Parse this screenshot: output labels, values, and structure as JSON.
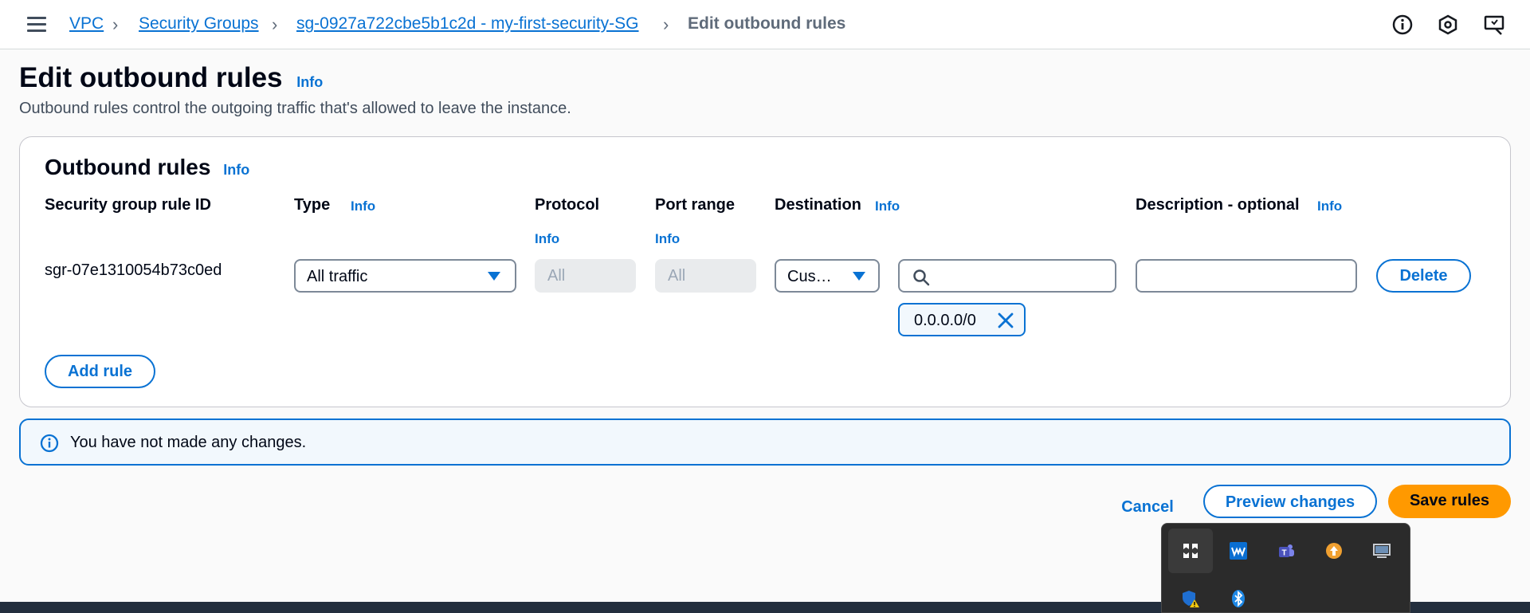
{
  "breadcrumb": {
    "items": [
      "VPC",
      "Security Groups",
      "sg-0927a722cbe5b1c2d - my-first-security-SG"
    ],
    "current": "Edit outbound rules"
  },
  "header": {
    "title": "Edit outbound rules",
    "info": "Info",
    "description": "Outbound rules control the outgoing traffic that's allowed to leave the instance."
  },
  "rules_panel": {
    "title": "Outbound rules",
    "info": "Info",
    "columns": {
      "rule_id": "Security group rule ID",
      "type": "Type",
      "protocol": "Protocol",
      "port_range": "Port range",
      "destination": "Destination",
      "description": "Description - optional"
    },
    "column_info": "Info",
    "rows": [
      {
        "rule_id": "sgr-07e1310054b73c0ed",
        "type": "All traffic",
        "protocol": "All",
        "port_range": "All",
        "destination_type": "Cus…",
        "destination_search": "",
        "destination_token": "0.0.0.0/0",
        "description": "",
        "delete_label": "Delete"
      }
    ],
    "add_rule_label": "Add rule"
  },
  "alert": {
    "text": "You have not made any changes."
  },
  "actions": {
    "cancel": "Cancel",
    "preview": "Preview changes",
    "save": "Save rules"
  },
  "colors": {
    "link": "#0972d3",
    "primary_button": "#ff9900",
    "alert_bg": "#f2f8fd",
    "tray_bg": "#2b2b2b"
  },
  "tray_icons": [
    "app-launcher-icon",
    "waves-icon",
    "teams-icon",
    "update-arrow-icon",
    "display-icon",
    "security-warning-icon",
    "bluetooth-icon"
  ]
}
